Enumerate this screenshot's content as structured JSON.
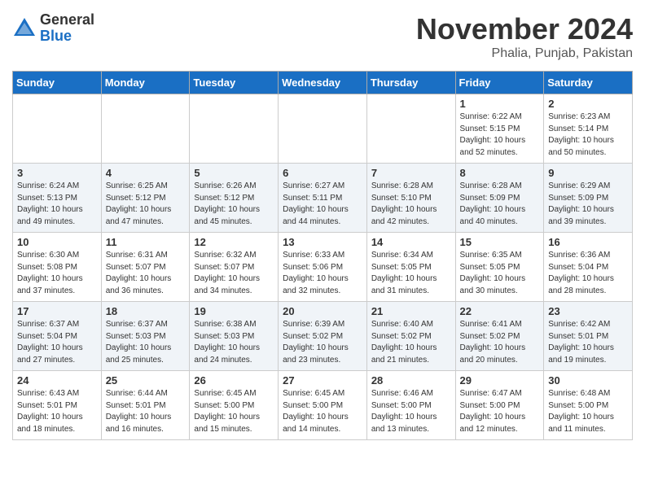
{
  "logo": {
    "general": "General",
    "blue": "Blue"
  },
  "header": {
    "month": "November 2024",
    "location": "Phalia, Punjab, Pakistan"
  },
  "days_of_week": [
    "Sunday",
    "Monday",
    "Tuesday",
    "Wednesday",
    "Thursday",
    "Friday",
    "Saturday"
  ],
  "weeks": [
    [
      {
        "day": "",
        "info": ""
      },
      {
        "day": "",
        "info": ""
      },
      {
        "day": "",
        "info": ""
      },
      {
        "day": "",
        "info": ""
      },
      {
        "day": "",
        "info": ""
      },
      {
        "day": "1",
        "info": "Sunrise: 6:22 AM\nSunset: 5:15 PM\nDaylight: 10 hours\nand 52 minutes."
      },
      {
        "day": "2",
        "info": "Sunrise: 6:23 AM\nSunset: 5:14 PM\nDaylight: 10 hours\nand 50 minutes."
      }
    ],
    [
      {
        "day": "3",
        "info": "Sunrise: 6:24 AM\nSunset: 5:13 PM\nDaylight: 10 hours\nand 49 minutes."
      },
      {
        "day": "4",
        "info": "Sunrise: 6:25 AM\nSunset: 5:12 PM\nDaylight: 10 hours\nand 47 minutes."
      },
      {
        "day": "5",
        "info": "Sunrise: 6:26 AM\nSunset: 5:12 PM\nDaylight: 10 hours\nand 45 minutes."
      },
      {
        "day": "6",
        "info": "Sunrise: 6:27 AM\nSunset: 5:11 PM\nDaylight: 10 hours\nand 44 minutes."
      },
      {
        "day": "7",
        "info": "Sunrise: 6:28 AM\nSunset: 5:10 PM\nDaylight: 10 hours\nand 42 minutes."
      },
      {
        "day": "8",
        "info": "Sunrise: 6:28 AM\nSunset: 5:09 PM\nDaylight: 10 hours\nand 40 minutes."
      },
      {
        "day": "9",
        "info": "Sunrise: 6:29 AM\nSunset: 5:09 PM\nDaylight: 10 hours\nand 39 minutes."
      }
    ],
    [
      {
        "day": "10",
        "info": "Sunrise: 6:30 AM\nSunset: 5:08 PM\nDaylight: 10 hours\nand 37 minutes."
      },
      {
        "day": "11",
        "info": "Sunrise: 6:31 AM\nSunset: 5:07 PM\nDaylight: 10 hours\nand 36 minutes."
      },
      {
        "day": "12",
        "info": "Sunrise: 6:32 AM\nSunset: 5:07 PM\nDaylight: 10 hours\nand 34 minutes."
      },
      {
        "day": "13",
        "info": "Sunrise: 6:33 AM\nSunset: 5:06 PM\nDaylight: 10 hours\nand 32 minutes."
      },
      {
        "day": "14",
        "info": "Sunrise: 6:34 AM\nSunset: 5:05 PM\nDaylight: 10 hours\nand 31 minutes."
      },
      {
        "day": "15",
        "info": "Sunrise: 6:35 AM\nSunset: 5:05 PM\nDaylight: 10 hours\nand 30 minutes."
      },
      {
        "day": "16",
        "info": "Sunrise: 6:36 AM\nSunset: 5:04 PM\nDaylight: 10 hours\nand 28 minutes."
      }
    ],
    [
      {
        "day": "17",
        "info": "Sunrise: 6:37 AM\nSunset: 5:04 PM\nDaylight: 10 hours\nand 27 minutes."
      },
      {
        "day": "18",
        "info": "Sunrise: 6:37 AM\nSunset: 5:03 PM\nDaylight: 10 hours\nand 25 minutes."
      },
      {
        "day": "19",
        "info": "Sunrise: 6:38 AM\nSunset: 5:03 PM\nDaylight: 10 hours\nand 24 minutes."
      },
      {
        "day": "20",
        "info": "Sunrise: 6:39 AM\nSunset: 5:02 PM\nDaylight: 10 hours\nand 23 minutes."
      },
      {
        "day": "21",
        "info": "Sunrise: 6:40 AM\nSunset: 5:02 PM\nDaylight: 10 hours\nand 21 minutes."
      },
      {
        "day": "22",
        "info": "Sunrise: 6:41 AM\nSunset: 5:02 PM\nDaylight: 10 hours\nand 20 minutes."
      },
      {
        "day": "23",
        "info": "Sunrise: 6:42 AM\nSunset: 5:01 PM\nDaylight: 10 hours\nand 19 minutes."
      }
    ],
    [
      {
        "day": "24",
        "info": "Sunrise: 6:43 AM\nSunset: 5:01 PM\nDaylight: 10 hours\nand 18 minutes."
      },
      {
        "day": "25",
        "info": "Sunrise: 6:44 AM\nSunset: 5:01 PM\nDaylight: 10 hours\nand 16 minutes."
      },
      {
        "day": "26",
        "info": "Sunrise: 6:45 AM\nSunset: 5:00 PM\nDaylight: 10 hours\nand 15 minutes."
      },
      {
        "day": "27",
        "info": "Sunrise: 6:45 AM\nSunset: 5:00 PM\nDaylight: 10 hours\nand 14 minutes."
      },
      {
        "day": "28",
        "info": "Sunrise: 6:46 AM\nSunset: 5:00 PM\nDaylight: 10 hours\nand 13 minutes."
      },
      {
        "day": "29",
        "info": "Sunrise: 6:47 AM\nSunset: 5:00 PM\nDaylight: 10 hours\nand 12 minutes."
      },
      {
        "day": "30",
        "info": "Sunrise: 6:48 AM\nSunset: 5:00 PM\nDaylight: 10 hours\nand 11 minutes."
      }
    ]
  ]
}
